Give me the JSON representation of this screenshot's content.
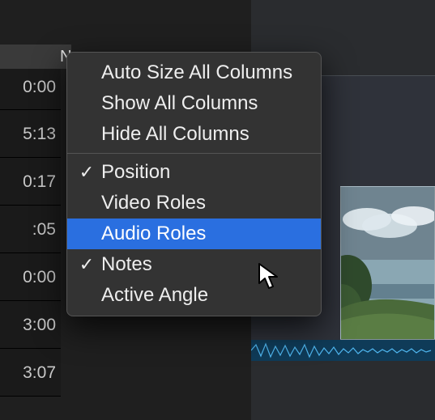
{
  "header": {
    "stub_text": "N"
  },
  "timecodes": [
    "0:00",
    "5:13",
    "0:17",
    ":05",
    "0:00",
    "3:00",
    "3:07"
  ],
  "menu": {
    "auto_size": "Auto Size All Columns",
    "show_all": "Show All Columns",
    "hide_all": "Hide All Columns",
    "position": "Position",
    "video_roles": "Video Roles",
    "audio_roles": "Audio Roles",
    "notes": "Notes",
    "active_angle": "Active Angle",
    "check_glyph": "✓",
    "checked": {
      "position": true,
      "notes": true
    },
    "highlighted": "audio_roles"
  }
}
